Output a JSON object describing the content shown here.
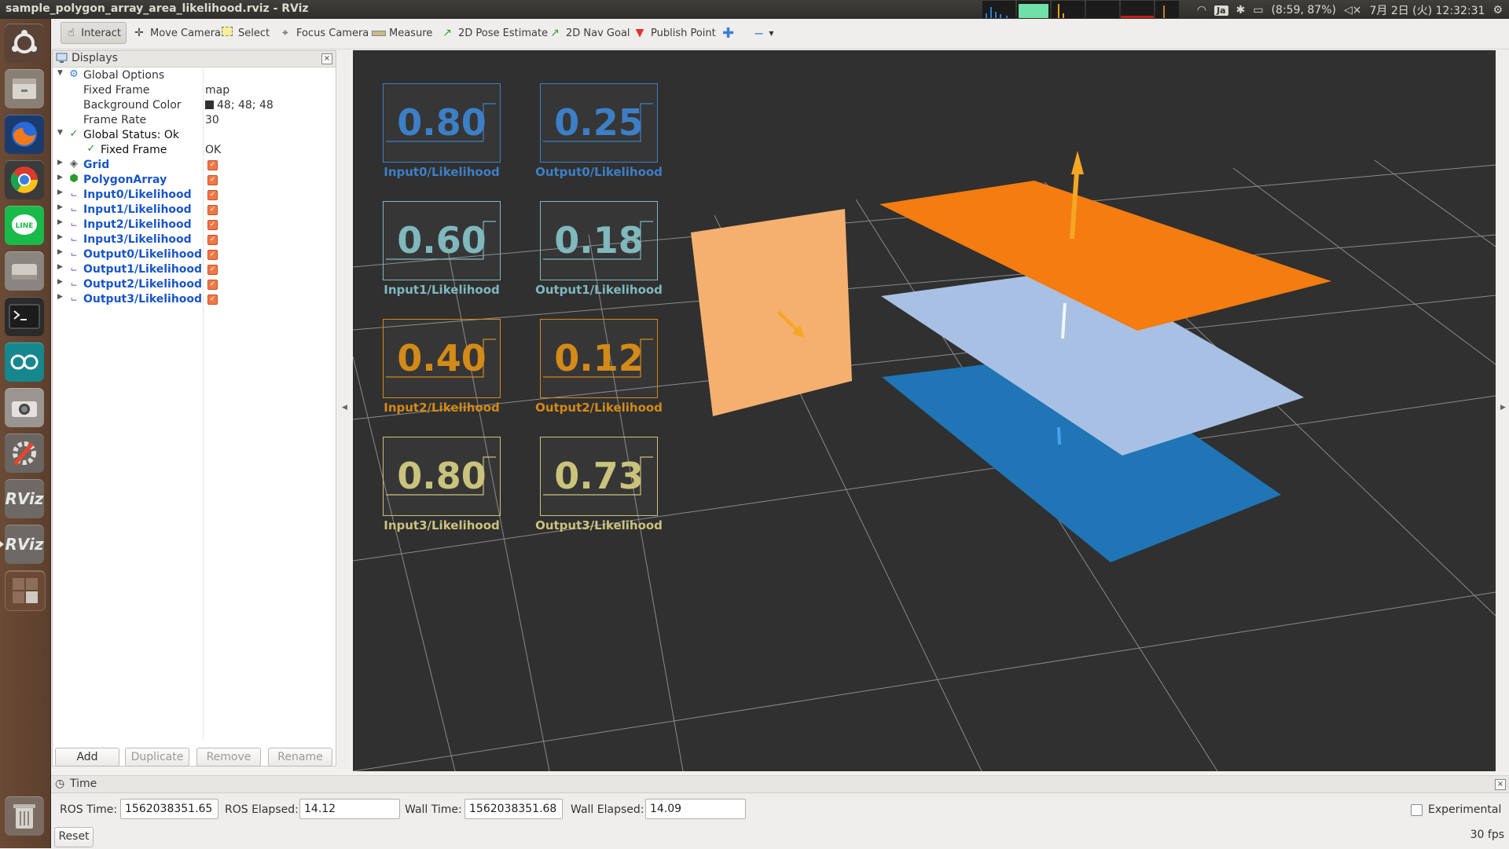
{
  "window": {
    "title": "sample_polygon_array_area_likelihood.rviz - RViz"
  },
  "tray": {
    "battery": "(8:59, 87%)",
    "ime": "Ja",
    "datetime": "7月 2日 (火) 12:32:31"
  },
  "launcher": {
    "items": [
      "ubuntu-dash",
      "file-manager",
      "firefox",
      "chrome",
      "line",
      "disk",
      "terminal",
      "arduino",
      "screenshot",
      "system-settings",
      "rviz",
      "rviz",
      "workspace-switcher",
      "trash"
    ],
    "rviz_label": "RViz"
  },
  "toolbar": {
    "interact": "Interact",
    "move_camera": "Move Camera",
    "select": "Select",
    "focus_camera": "Focus Camera",
    "measure": "Measure",
    "pose_estimate": "2D Pose Estimate",
    "nav_goal": "2D Nav Goal",
    "publish_point": "Publish Point"
  },
  "displays": {
    "title": "Displays",
    "global_options": "Global Options",
    "fixed_frame_label": "Fixed Frame",
    "fixed_frame_value": "map",
    "bg_color_label": "Background Color",
    "bg_color_value": "48; 48; 48",
    "frame_rate_label": "Frame Rate",
    "frame_rate_value": "30",
    "global_status": "Global Status: Ok",
    "status_fixed_frame": "Fixed Frame",
    "status_value": "OK",
    "items": [
      "Grid",
      "PolygonArray",
      "Input0/Likelihood",
      "Input1/Likelihood",
      "Input2/Likelihood",
      "Input3/Likelihood",
      "Output0/Likelihood",
      "Output1/Likelihood",
      "Output2/Likelihood",
      "Output3/Likelihood"
    ],
    "buttons": {
      "add": "Add",
      "duplicate": "Duplicate",
      "remove": "Remove",
      "rename": "Rename"
    }
  },
  "overlays": [
    {
      "value": "0.80",
      "label": "Input0/Likelihood",
      "color": "#3d7fc6"
    },
    {
      "value": "0.25",
      "label": "Output0/Likelihood",
      "color": "#3d7fc6"
    },
    {
      "value": "0.60",
      "label": "Input1/Likelihood",
      "color": "#7fb8bd"
    },
    {
      "value": "0.18",
      "label": "Output1/Likelihood",
      "color": "#7fb8bd"
    },
    {
      "value": "0.40",
      "label": "Input2/Likelihood",
      "color": "#d48a18"
    },
    {
      "value": "0.12",
      "label": "Output2/Likelihood",
      "color": "#d48a18"
    },
    {
      "value": "0.80",
      "label": "Input3/Likelihood",
      "color": "#c9c37c"
    },
    {
      "value": "0.73",
      "label": "Output3/Likelihood",
      "color": "#c9c37c"
    }
  ],
  "scene_colors": {
    "background": "#303030",
    "grid": "#8a8a8a",
    "plane_orange": "#f47c10",
    "plane_peach": "#f5b06f",
    "plane_lightblue": "#a8c0e3",
    "plane_blue": "#1f75b5",
    "arrow": "#f5a623"
  },
  "time": {
    "title": "Time",
    "ros_time_label": "ROS Time:",
    "ros_time": "1562038351.65",
    "ros_elapsed_label": "ROS Elapsed:",
    "ros_elapsed": "14.12",
    "wall_time_label": "Wall Time:",
    "wall_time": "1562038351.68",
    "wall_elapsed_label": "Wall Elapsed:",
    "wall_elapsed": "14.09",
    "experimental": "Experimental",
    "reset": "Reset",
    "fps": "30 fps"
  }
}
